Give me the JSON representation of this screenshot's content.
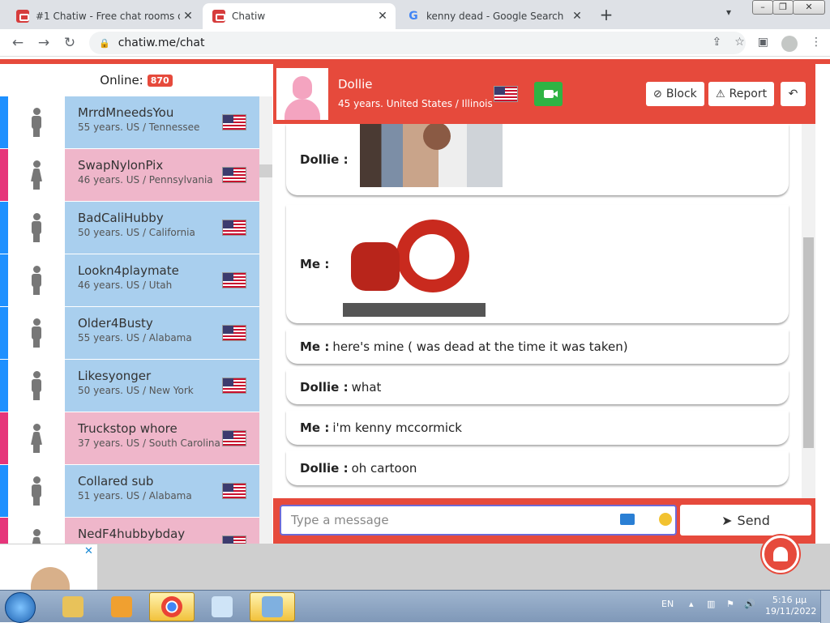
{
  "browser": {
    "tabs": [
      {
        "title": "#1 Chatiw - Free chat rooms onli",
        "active": false
      },
      {
        "title": "Chatiw",
        "active": true
      },
      {
        "title": "kenny dead - Google Search",
        "active": false
      }
    ],
    "new_tab": "+",
    "url": "chatiw.me/chat",
    "window_buttons": [
      "–",
      "❐",
      "✕"
    ]
  },
  "sidebar": {
    "online_label": "Online:",
    "online_count": "870",
    "users": [
      {
        "name": "MrrdMneedsYou",
        "meta": "55 years. US / Tennessee",
        "gender": "m"
      },
      {
        "name": "SwapNylonPix",
        "meta": "46 years. US / Pennsylvania",
        "gender": "f"
      },
      {
        "name": "BadCaliHubby",
        "meta": "50 years. US / California",
        "gender": "m"
      },
      {
        "name": "Lookn4playmate",
        "meta": "46 years. US / Utah",
        "gender": "m"
      },
      {
        "name": "Older4Busty",
        "meta": "55 years. US / Alabama",
        "gender": "m"
      },
      {
        "name": "Likesyonger",
        "meta": "50 years. US / New York",
        "gender": "m"
      },
      {
        "name": "Truckstop whore",
        "meta": "37 years. US / South Carolina",
        "gender": "f"
      },
      {
        "name": "Collared sub",
        "meta": "51 years. US / Alabama",
        "gender": "m"
      },
      {
        "name": "NedF4hubbybday",
        "meta": "",
        "gender": "f"
      }
    ]
  },
  "chat": {
    "partner_name": "Dollie",
    "partner_meta": "45 years. United States / Illinois",
    "block_label": "Block",
    "report_label": "Report",
    "messages": [
      {
        "sender": "Dollie :",
        "text": ""
      },
      {
        "sender": "Me :",
        "text": ""
      },
      {
        "sender": "Me :",
        "text": "here's mine ( was dead at the time it was taken)"
      },
      {
        "sender": "Dollie :",
        "text": "what"
      },
      {
        "sender": "Me :",
        "text": "i'm kenny mccormick"
      },
      {
        "sender": "Dollie :",
        "text": "oh cartoon"
      }
    ],
    "input_placeholder": "Type a message",
    "send_label": "Send"
  },
  "taskbar": {
    "language": "EN",
    "time": "5:16 µµ",
    "date": "19/11/2022"
  },
  "colors": {
    "accent": "#e64a3c",
    "male": "#a9cfee",
    "female": "#efb6ca"
  }
}
